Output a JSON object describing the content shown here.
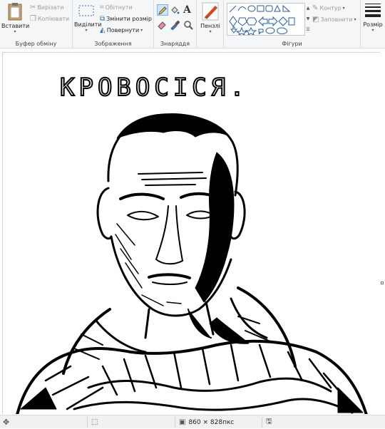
{
  "ribbon": {
    "clipboard": {
      "paste_label": "Вставити",
      "cut_label": "Вирізати",
      "copy_label": "Копіювати",
      "group_label": "Буфер обміну"
    },
    "image": {
      "select_label": "Виділити",
      "crop_label": "Обітнути",
      "resize_label": "Змінити розмір",
      "rotate_label": "Повернути",
      "group_label": "Зображення"
    },
    "tools": {
      "group_label": "Знаряддя"
    },
    "brushes": {
      "label": "Пензлі"
    },
    "shapes": {
      "outline_label": "Контур",
      "fill_label": "Заповнити",
      "group_label": "Фігури"
    },
    "size": {
      "label": "Розмір"
    }
  },
  "canvas": {
    "drawing_caption": "КРОВОСІСЯ.",
    "background": "#ffffff",
    "ink": "#000000"
  },
  "statusbar": {
    "image_size": "860 × 828пкс"
  },
  "colors": {
    "ribbon_bg": "#f5f6f7",
    "accent_blue": "#1e6fd0",
    "selected_tool": "#cde4f7"
  }
}
